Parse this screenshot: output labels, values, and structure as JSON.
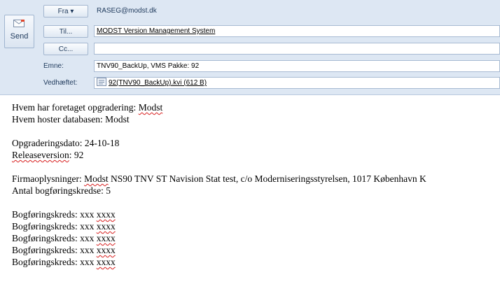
{
  "compose": {
    "send_label": "Send",
    "from_button": "Fra ▾",
    "from_value": "RASEG@modst.dk",
    "to_button": "Til...",
    "to_value": "MODST Version Management System",
    "cc_button": "Cc...",
    "cc_value": "",
    "subject_label": "Emne:",
    "subject_value": "TNV90_BackUp, VMS Pakke: 92",
    "attachment_label": "Vedhæftet:",
    "attachment_value": "92(TNV90_BackUp).kvi (612 B)"
  },
  "body": {
    "line1_prefix": "Hvem har foretaget opgradering: ",
    "line1_value": "Modst",
    "line2": "Hvem hoster databasen: Modst",
    "line3": "Opgraderingsdato: 24-10-18",
    "line4_label": "Releaseversion",
    "line4_rest": ": 92",
    "line5_prefix": "Firmaoplysninger: ",
    "line5_name": "Modst",
    "line5_rest": " NS90 TNV ST Navision Stat test, c/o Moderniseringsstyrelsen, 1017 København K",
    "line6": "Antal bogføringskredse: 5",
    "kreds_prefix": "Bogføringskreds: xxx ",
    "kreds_value": "xxxx"
  }
}
